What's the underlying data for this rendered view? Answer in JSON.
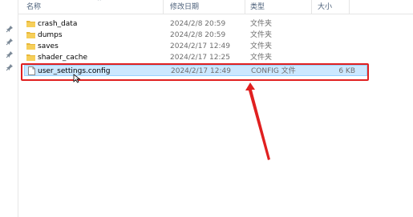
{
  "columns": {
    "name": "名称",
    "date": "修改日期",
    "type": "类型",
    "size": "大小"
  },
  "files": [
    {
      "name": "crash_data",
      "date": "2024/2/8 20:59",
      "type": "文件夹",
      "size": "",
      "kind": "folder"
    },
    {
      "name": "dumps",
      "date": "2024/2/8 20:59",
      "type": "文件夹",
      "size": "",
      "kind": "folder"
    },
    {
      "name": "saves",
      "date": "2024/2/17 12:49",
      "type": "文件夹",
      "size": "",
      "kind": "folder"
    },
    {
      "name": "shader_cache",
      "date": "2024/2/17 12:25",
      "type": "文件夹",
      "size": "",
      "kind": "folder"
    },
    {
      "name": "user_settings.config",
      "date": "2024/2/17 12:49",
      "type": "CONFIG 文件",
      "size": "6 KB",
      "kind": "file",
      "selected": true
    }
  ],
  "colors": {
    "selection": "#cce8ff",
    "selection_border": "#99d1ff",
    "highlight_annotation": "#e02020",
    "folder": "#e8b83a"
  },
  "quick_access_pins": [
    "pin-icon",
    "pin-icon",
    "pin-icon",
    "pin-icon"
  ]
}
